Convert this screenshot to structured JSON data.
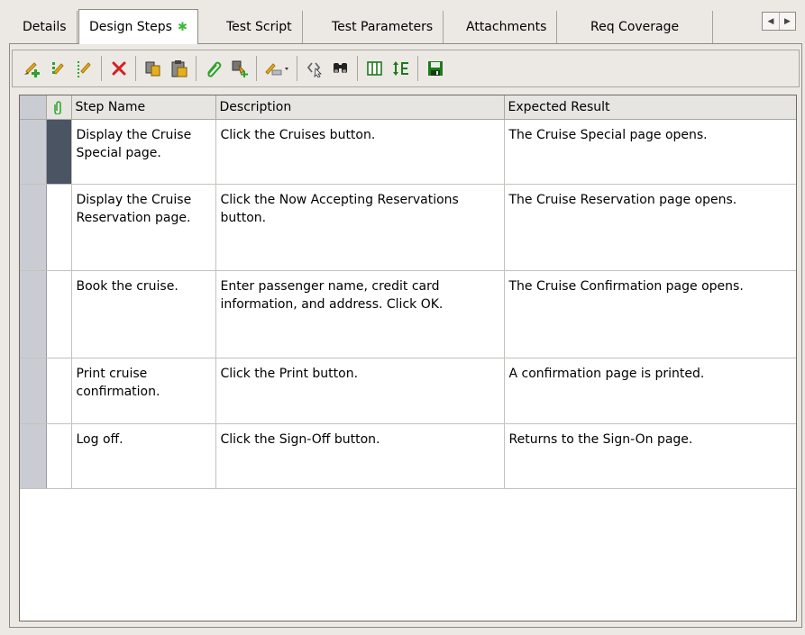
{
  "tabs": [
    {
      "label": "Details",
      "active": false
    },
    {
      "label": "Design Steps",
      "active": true,
      "icon": "modified-asterisk-icon",
      "icon_glyph": "✱"
    },
    {
      "label": "Test Script",
      "active": false
    },
    {
      "label": "Test Parameters",
      "active": false
    },
    {
      "label": "Attachments",
      "active": false
    },
    {
      "label": "Req Coverage",
      "active": false
    }
  ],
  "tab_scroll": {
    "left_glyph": "◀",
    "right_glyph": "▶"
  },
  "toolbar": {
    "buttons": [
      "new-step-icon",
      "insert-step-icon",
      "edit-step-icon",
      "delete-step-icon",
      "copy-steps-icon",
      "paste-steps-icon",
      "attachments-icon",
      "call-to-test-icon",
      "insert-parameter-icon",
      "generate-script-icon",
      "find-icon",
      "select-columns-icon",
      "adjust-row-height-icon",
      "save-icon"
    ]
  },
  "grid": {
    "columns": [
      "Step Name",
      "Description",
      "Expected Result"
    ],
    "attachment_header_icon": "paperclip-icon",
    "rows": [
      {
        "step_name": "Display the Cruise Special page.",
        "description": "Click the Cruises button.",
        "expected": "The Cruise Special page opens.",
        "current": true
      },
      {
        "step_name": "Display the Cruise Reservation page.",
        "description": "Click the Now Accepting Reservations button.",
        "expected": "The Cruise Reservation page opens.",
        "current": false
      },
      {
        "step_name": "Book the cruise.",
        "description": "Enter passenger name, credit card information, and address. Click OK.",
        "expected": "The Cruise Confirmation page opens.",
        "current": false
      },
      {
        "step_name": "Print cruise confirmation.",
        "description": "Click the Print button.",
        "expected": "A confirmation page is printed.",
        "current": false
      },
      {
        "step_name": "Log off.",
        "description": "Click the Sign-Off button.",
        "expected": "Returns to the Sign-On page.",
        "current": false
      }
    ]
  },
  "colors": {
    "active_tab_icon": "#3ab93a",
    "delete_red": "#d42020",
    "current_row_marker": "#4a5462",
    "row_header": "#c9ccd2"
  }
}
